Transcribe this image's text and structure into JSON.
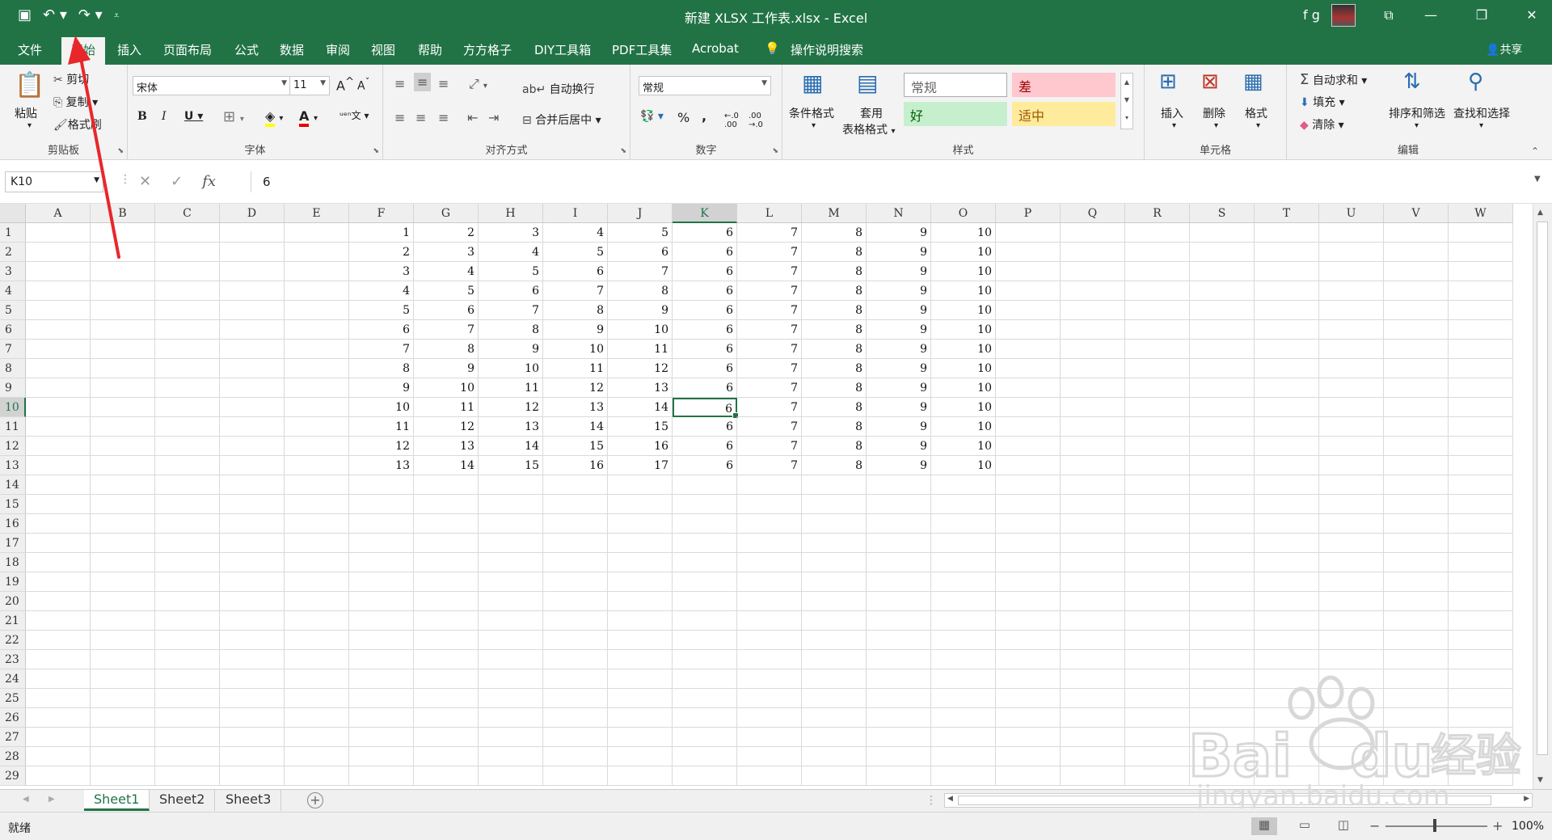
{
  "titlebar": {
    "title": "新建 XLSX 工作表.xlsx  -  Excel",
    "user": "f g"
  },
  "tabs": {
    "items": [
      "文件",
      "开始",
      "插入",
      "页面布局",
      "公式",
      "数据",
      "审阅",
      "视图",
      "帮助",
      "方方格子",
      "DIY工具箱",
      "PDF工具集",
      "Acrobat",
      "操作说明搜索"
    ],
    "active": "开始",
    "share": "共享"
  },
  "ribbon": {
    "clipboard": {
      "paste": "粘贴",
      "cut": "剪切",
      "copy": "复制",
      "format_painter": "格式刷",
      "label": "剪贴板"
    },
    "font": {
      "name": "宋体",
      "size": "11",
      "bold": "B",
      "italic": "I",
      "underline": "U",
      "grow": "A",
      "shrink": "A",
      "label": "字体"
    },
    "alignment": {
      "wrap": "自动换行",
      "merge": "合并后居中",
      "label": "对齐方式"
    },
    "number": {
      "format": "常规",
      "percent": "%",
      "comma": ",",
      "label": "数字"
    },
    "styles": {
      "conditional": "条件格式",
      "table": "套用",
      "table2": "表格格式",
      "normal": "常规",
      "bad": "差",
      "good": "好",
      "neutral": "适中",
      "label": "样式"
    },
    "cells": {
      "insert": "插入",
      "delete": "删除",
      "format": "格式",
      "label": "单元格"
    },
    "editing": {
      "autosum": "自动求和",
      "fill": "填充",
      "clear": "清除",
      "sort": "排序和筛选",
      "find": "查找和选择",
      "label": "编辑"
    }
  },
  "formula_bar": {
    "name_box": "K10",
    "fx": "fx",
    "value": "6"
  },
  "grid": {
    "columns": [
      "A",
      "B",
      "C",
      "D",
      "E",
      "F",
      "G",
      "H",
      "I",
      "J",
      "K",
      "L",
      "M",
      "N",
      "O",
      "P",
      "Q",
      "R",
      "S",
      "T",
      "U",
      "V",
      "W"
    ],
    "selected_column": "K",
    "row_count": 29,
    "selected_row": 10,
    "data_start_column": "F",
    "rows": [
      [
        1,
        2,
        3,
        4,
        5,
        6,
        7,
        8,
        9,
        10
      ],
      [
        2,
        3,
        4,
        5,
        6,
        6,
        7,
        8,
        9,
        10
      ],
      [
        3,
        4,
        5,
        6,
        7,
        6,
        7,
        8,
        9,
        10
      ],
      [
        4,
        5,
        6,
        7,
        8,
        6,
        7,
        8,
        9,
        10
      ],
      [
        5,
        6,
        7,
        8,
        9,
        6,
        7,
        8,
        9,
        10
      ],
      [
        6,
        7,
        8,
        9,
        10,
        6,
        7,
        8,
        9,
        10
      ],
      [
        7,
        8,
        9,
        10,
        11,
        6,
        7,
        8,
        9,
        10
      ],
      [
        8,
        9,
        10,
        11,
        12,
        6,
        7,
        8,
        9,
        10
      ],
      [
        9,
        10,
        11,
        12,
        13,
        6,
        7,
        8,
        9,
        10
      ],
      [
        10,
        11,
        12,
        13,
        14,
        6,
        7,
        8,
        9,
        10
      ],
      [
        11,
        12,
        13,
        14,
        15,
        6,
        7,
        8,
        9,
        10
      ],
      [
        12,
        13,
        14,
        15,
        16,
        6,
        7,
        8,
        9,
        10
      ],
      [
        13,
        14,
        15,
        16,
        17,
        6,
        7,
        8,
        9,
        10
      ]
    ]
  },
  "sheets": {
    "tabs": [
      "Sheet1",
      "Sheet2",
      "Sheet3"
    ],
    "active": "Sheet1"
  },
  "status": {
    "ready": "就绪",
    "zoom": "100%"
  },
  "colors": {
    "excel_green": "#217346",
    "annotation_red": "#e8272b"
  }
}
